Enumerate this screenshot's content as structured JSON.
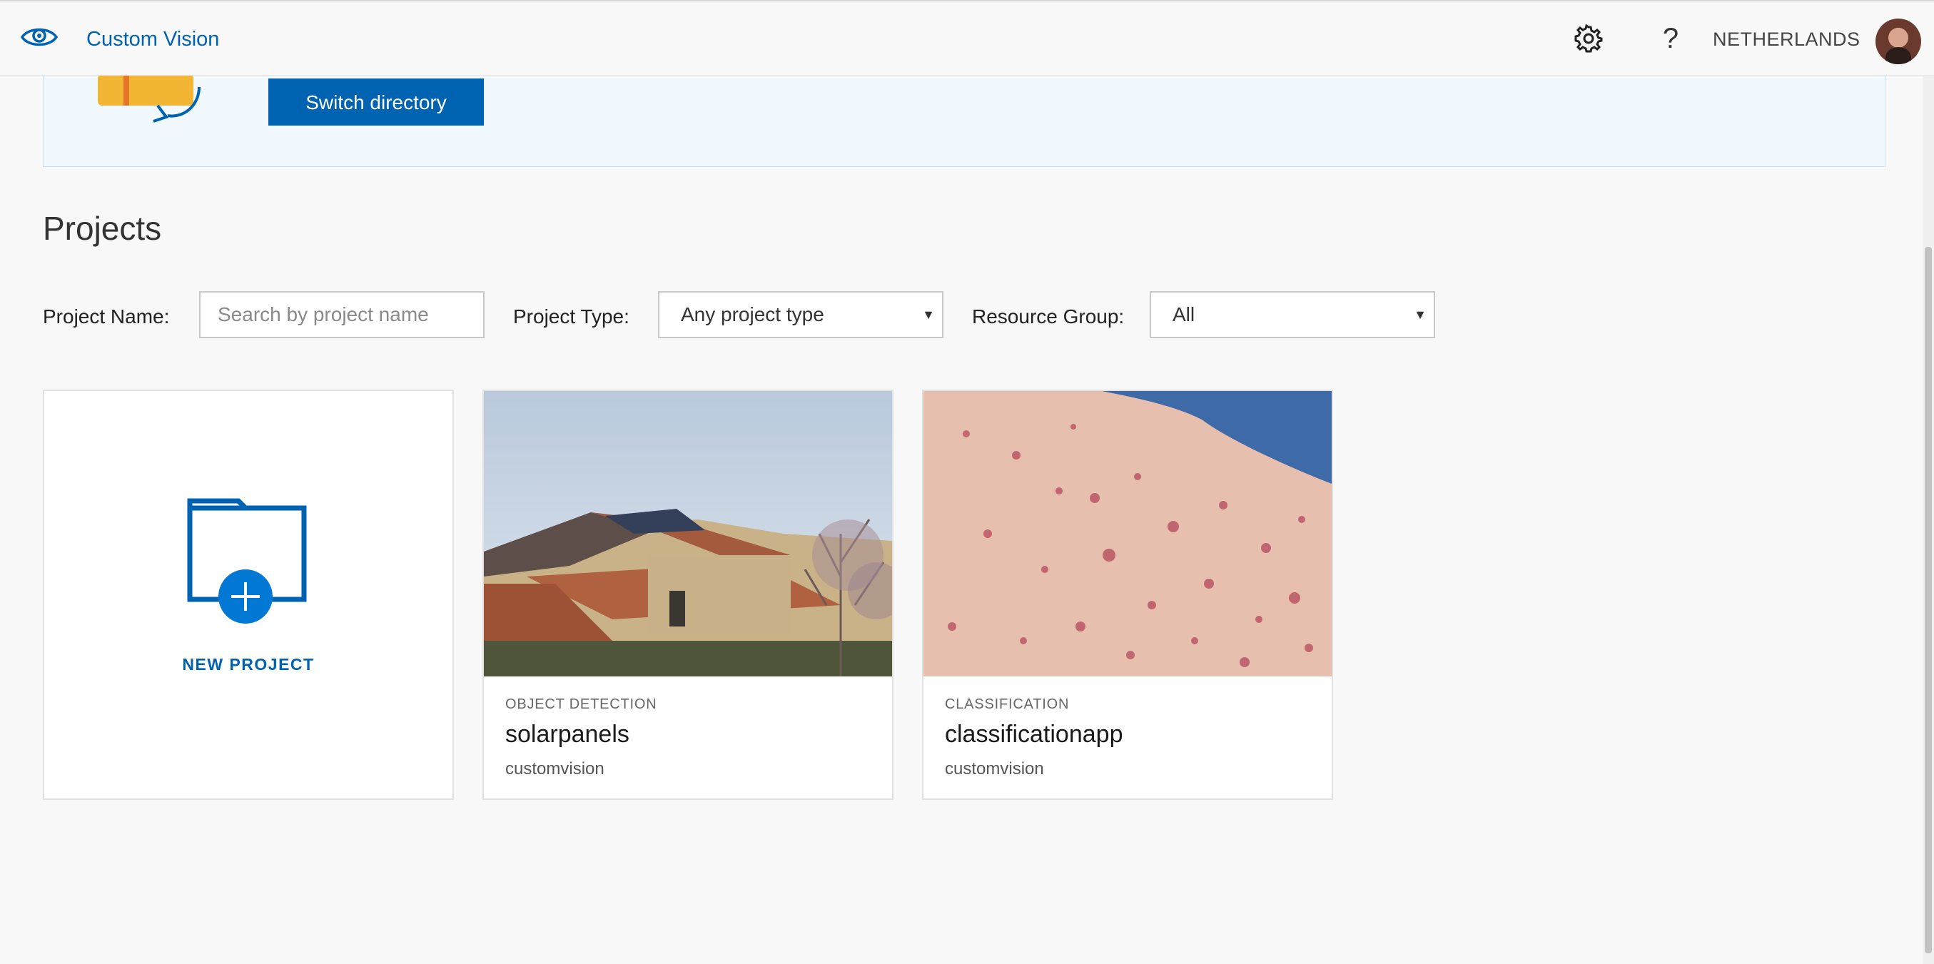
{
  "app": {
    "title": "Custom Vision",
    "region": "NETHERLANDS",
    "help_glyph": "?"
  },
  "banner": {
    "switch_label": "Switch directory"
  },
  "projects": {
    "heading": "Projects",
    "filters": {
      "name_label": "Project Name:",
      "name_placeholder": "Search by project name",
      "type_label": "Project Type:",
      "type_value": "Any project type",
      "group_label": "Resource Group:",
      "group_value": "All"
    },
    "new_project_label": "NEW PROJECT",
    "items": [
      {
        "type": "OBJECT DETECTION",
        "name": "solarpanels",
        "resource_group": "customvision"
      },
      {
        "type": "CLASSIFICATION",
        "name": "classificationapp",
        "resource_group": "customvision"
      }
    ]
  },
  "colors": {
    "accent": "#0063b1",
    "banner_bg": "#f1f8fe",
    "page_bg": "#f8f8f8"
  },
  "icons": [
    "eye-icon",
    "gear-icon",
    "help-icon",
    "folder-plus-icon",
    "caret-down-icon"
  ]
}
